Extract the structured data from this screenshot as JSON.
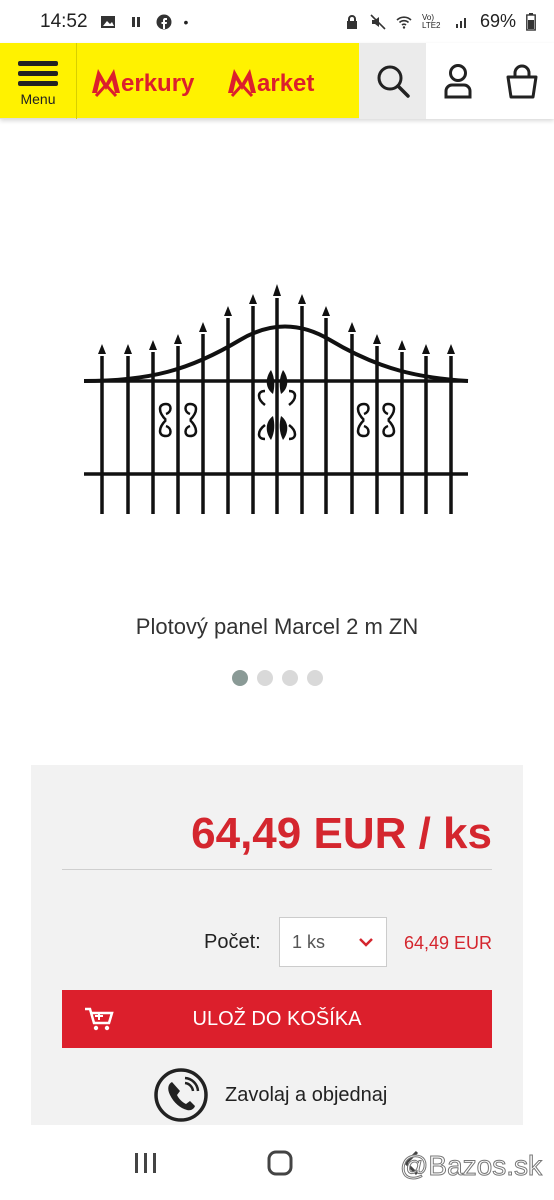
{
  "status": {
    "time": "14:52",
    "battery": "69%",
    "network": "Vo) LTE2"
  },
  "header": {
    "menu_label": "Menu",
    "logo_text": "MerkuryMarket",
    "colors": {
      "brand_yellow": "#fff200",
      "brand_red": "#dc1f2c"
    }
  },
  "product": {
    "title": "Plotový panel Marcel 2 m ZN",
    "image_icon": "fence-panel-image",
    "gallery_count": 4,
    "gallery_active": 1
  },
  "purchase": {
    "price": "64,49 EUR / ks",
    "qty_label": "Počet:",
    "qty_value": "1 ks",
    "qty_total": "64,49 EUR",
    "cart_button": "ULOŽ DO KOŠÍKA",
    "call_text": "Zavolaj a objednaj"
  },
  "watermark": "@Bazos.sk"
}
